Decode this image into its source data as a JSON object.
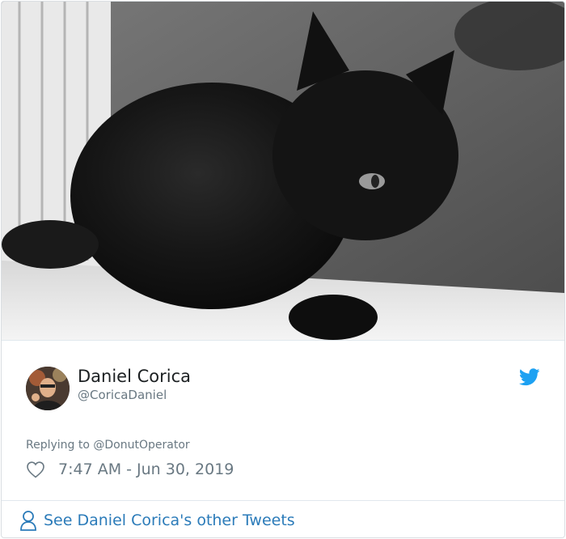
{
  "media": {
    "alt_icon": "cat-photo"
  },
  "author": {
    "name": "Daniel Corica",
    "handle": "@CoricaDaniel"
  },
  "tweet": {
    "reply_prefix": "Replying to ",
    "reply_mention": "@DonutOperator",
    "timestamp": "7:47 AM - Jun 30, 2019"
  },
  "footer": {
    "link_text": "See Daniel Corica's other Tweets"
  },
  "icons": {
    "brand": "twitter-bird-icon",
    "like": "heart-icon",
    "profile": "person-icon"
  },
  "colors": {
    "twitter_blue": "#1da1f2",
    "link_blue": "#2b7bb9",
    "muted_text": "#697882",
    "border": "#e1e8ed"
  }
}
